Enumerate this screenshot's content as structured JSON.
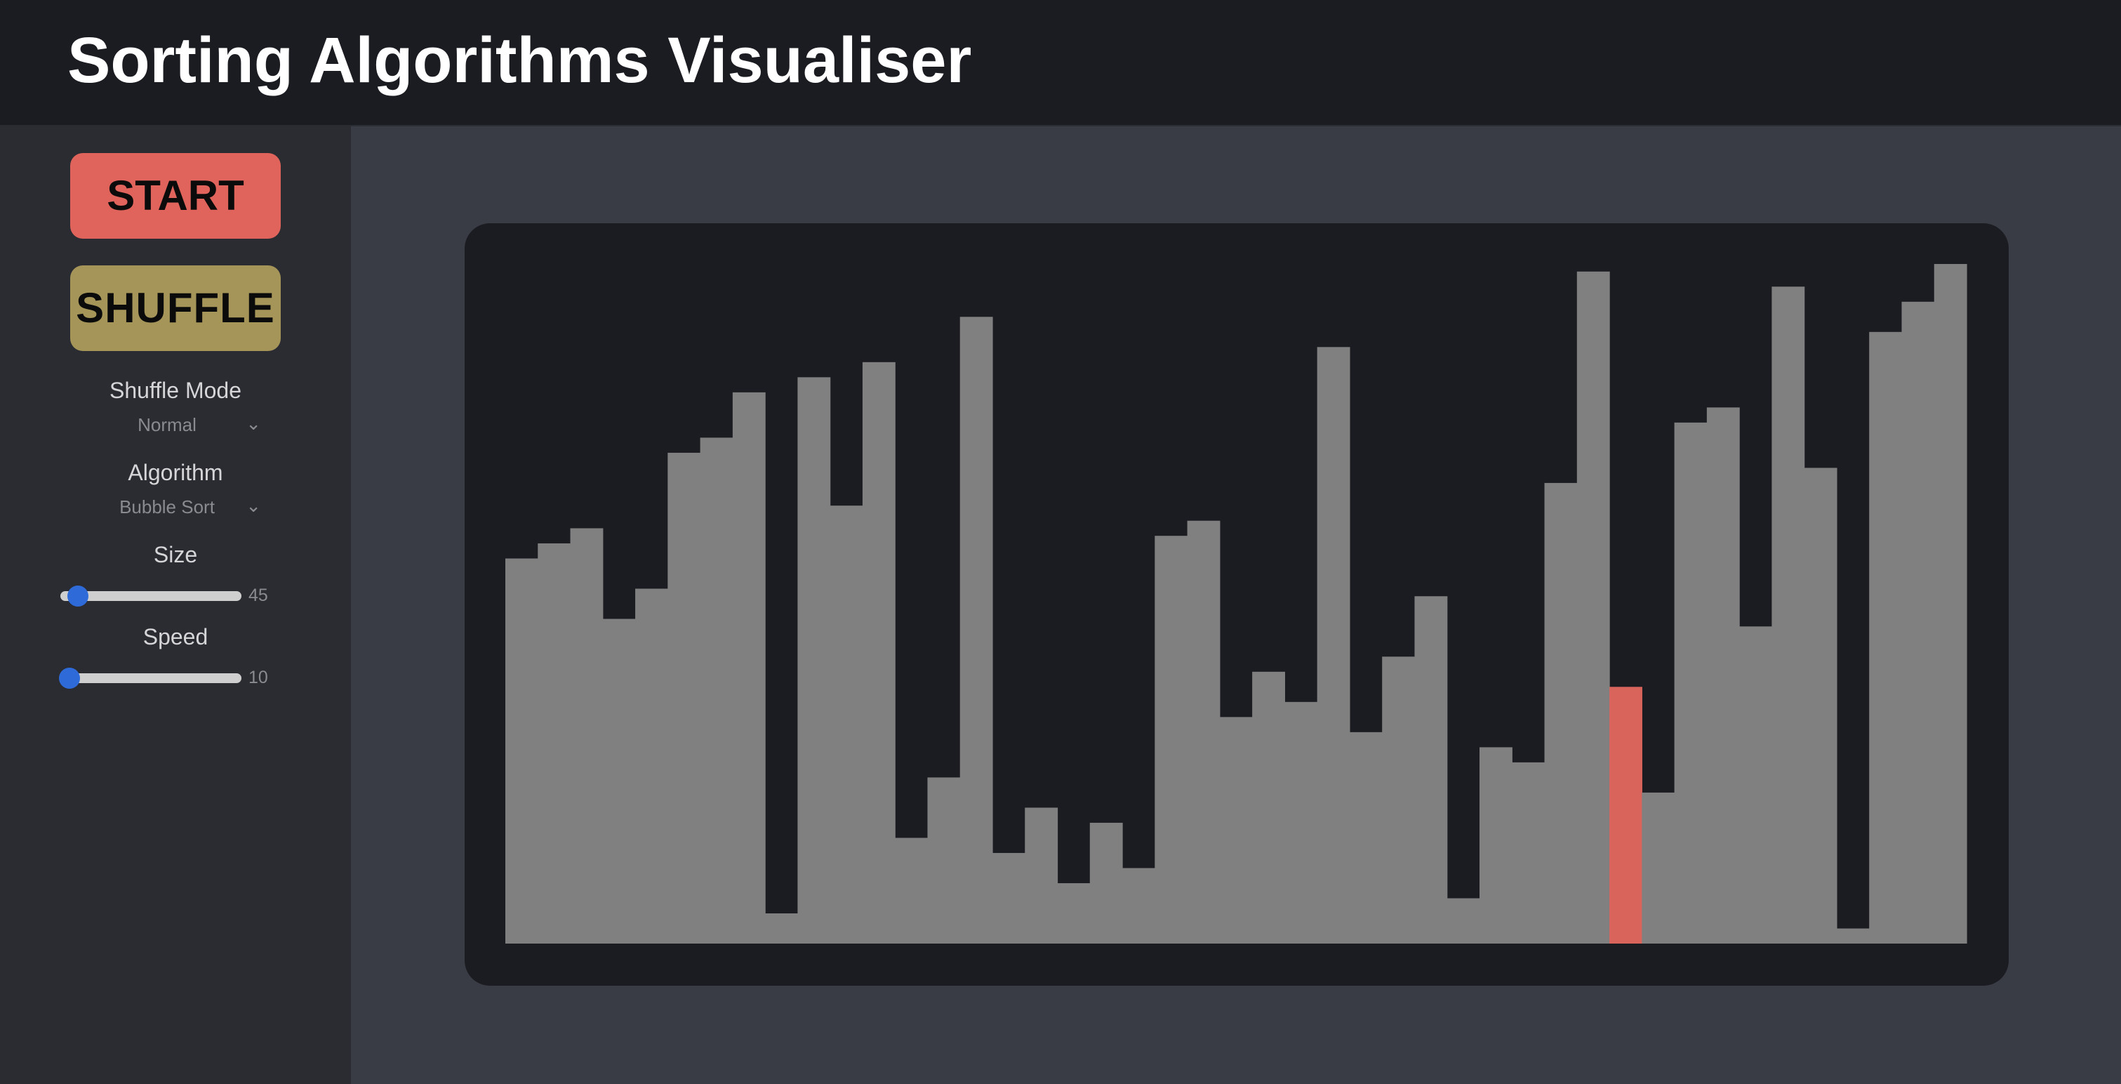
{
  "header": {
    "title": "Sorting Algorithms Visualiser"
  },
  "controls": {
    "start_label": "START",
    "shuffle_label": "SHUFFLE",
    "shuffle_mode": {
      "label": "Shuffle Mode",
      "value": "Normal"
    },
    "algorithm": {
      "label": "Algorithm",
      "value": "Bubble Sort"
    },
    "size": {
      "label": "Size",
      "value": "45",
      "fraction": 0.05
    },
    "speed": {
      "label": "Speed",
      "value": "10",
      "fraction": 0.0
    }
  },
  "colors": {
    "bar": "#808080",
    "highlight": "#d9645c",
    "start": "#e0645c",
    "shuffle": "#a59559",
    "slider_thumb": "#2e6bd9"
  },
  "chart_data": {
    "type": "bar",
    "values": [
      25.5,
      26.5,
      27.5,
      21.5,
      23.5,
      32.5,
      33.5,
      36.5,
      2,
      37.5,
      29,
      38.5,
      7,
      11,
      41.5,
      6,
      9,
      4,
      8,
      5,
      27,
      28,
      15,
      18,
      16,
      39.5,
      14,
      19,
      23,
      3,
      13,
      12,
      30.5,
      44.5,
      17,
      10,
      34.5,
      35.5,
      21,
      43.5,
      31.5,
      1,
      40.5,
      42.5,
      45
    ],
    "highlight_index": 34,
    "ylim": [
      0,
      45
    ]
  }
}
